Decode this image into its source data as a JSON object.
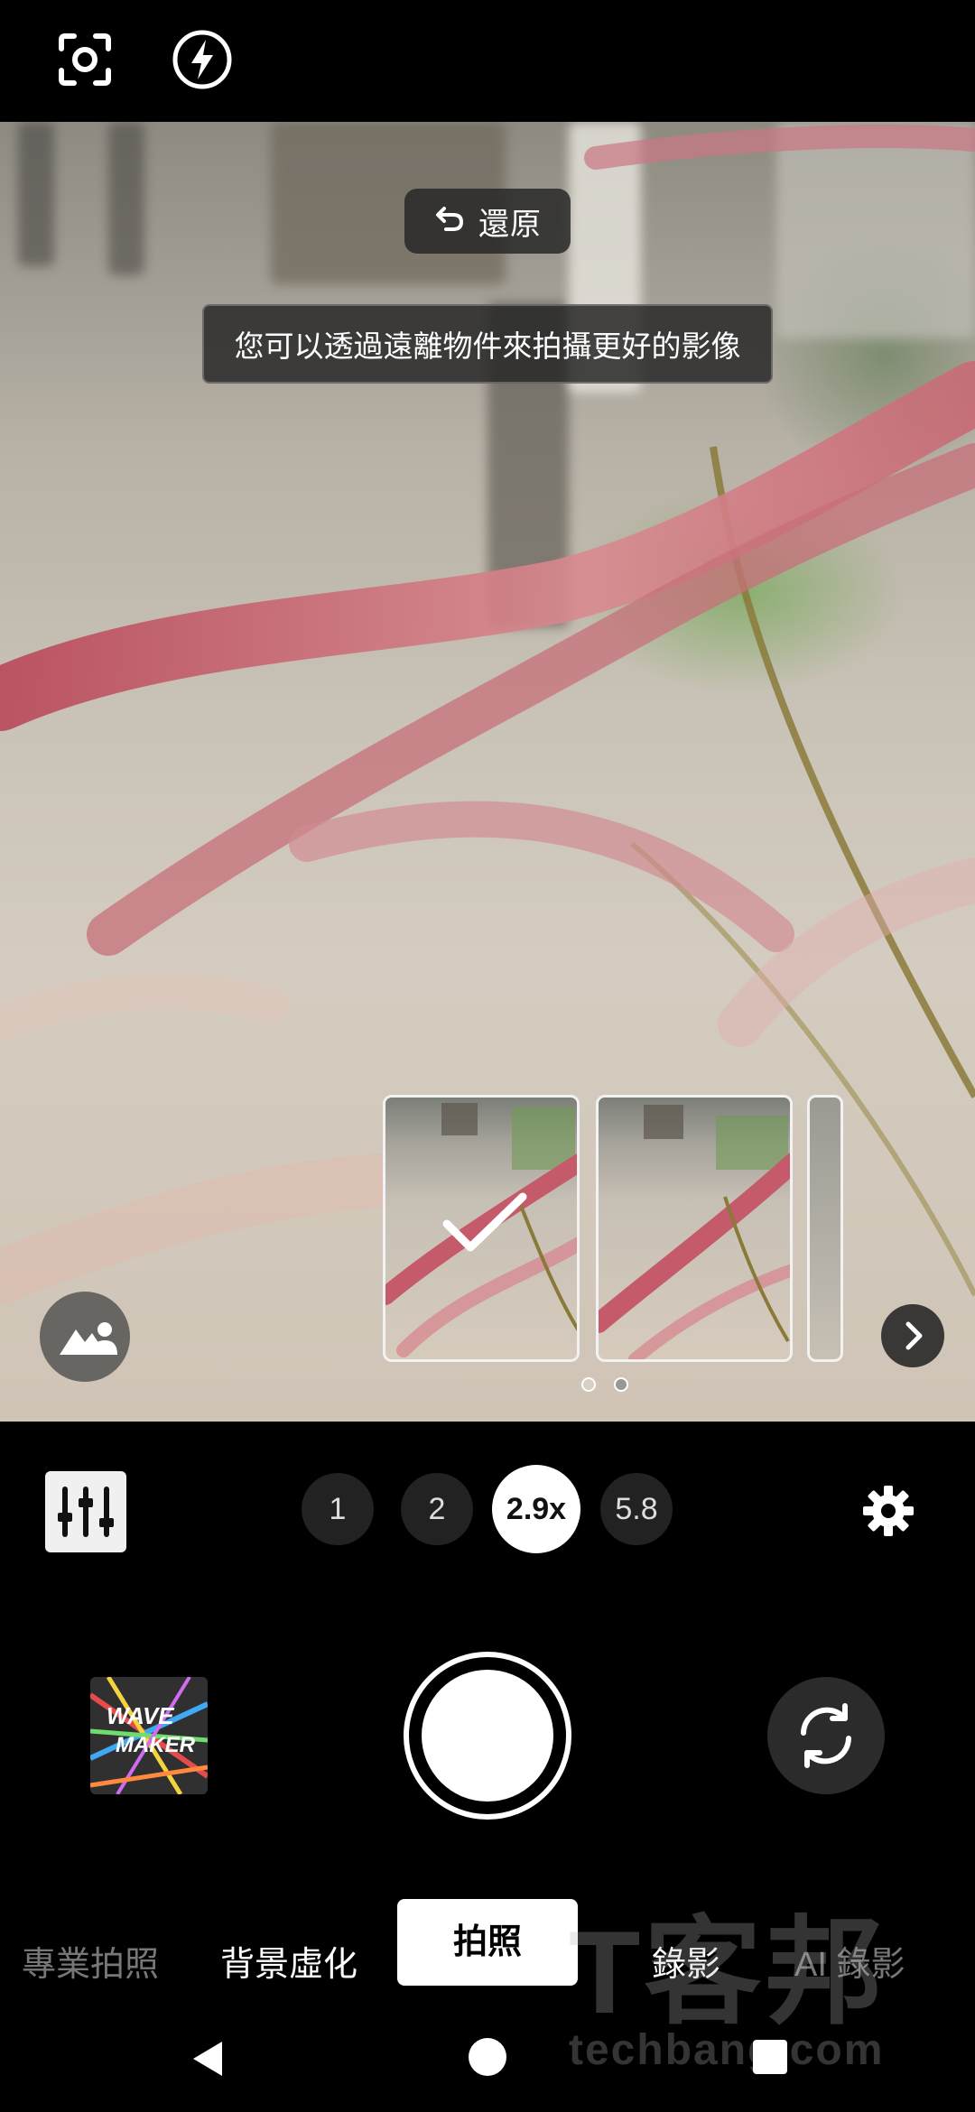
{
  "top_bar": {
    "icons": [
      "lens-scan-icon",
      "flash-auto-icon"
    ]
  },
  "viewfinder": {
    "restore_label": "還原",
    "tip_text": "您可以透過遠離物件來拍攝更好的影像",
    "thumbnail_pages": 2,
    "thumbnail_selected_index": 0
  },
  "zoom": {
    "levels": [
      "1",
      "2",
      "2.9x",
      "5.8"
    ],
    "selected": "2.9x"
  },
  "modes": {
    "items": [
      "專業拍照",
      "背景虛化",
      "拍照",
      "錄影",
      "AI 錄影"
    ],
    "selected": "拍照"
  },
  "gallery_thumb": {
    "text_line1": "WAVE",
    "text_line2": "MAKER"
  },
  "watermark": {
    "main": "T客邦",
    "url": "techbang.com"
  },
  "colors": {
    "accent_white": "#ffffff",
    "dark_button": "#222222"
  }
}
